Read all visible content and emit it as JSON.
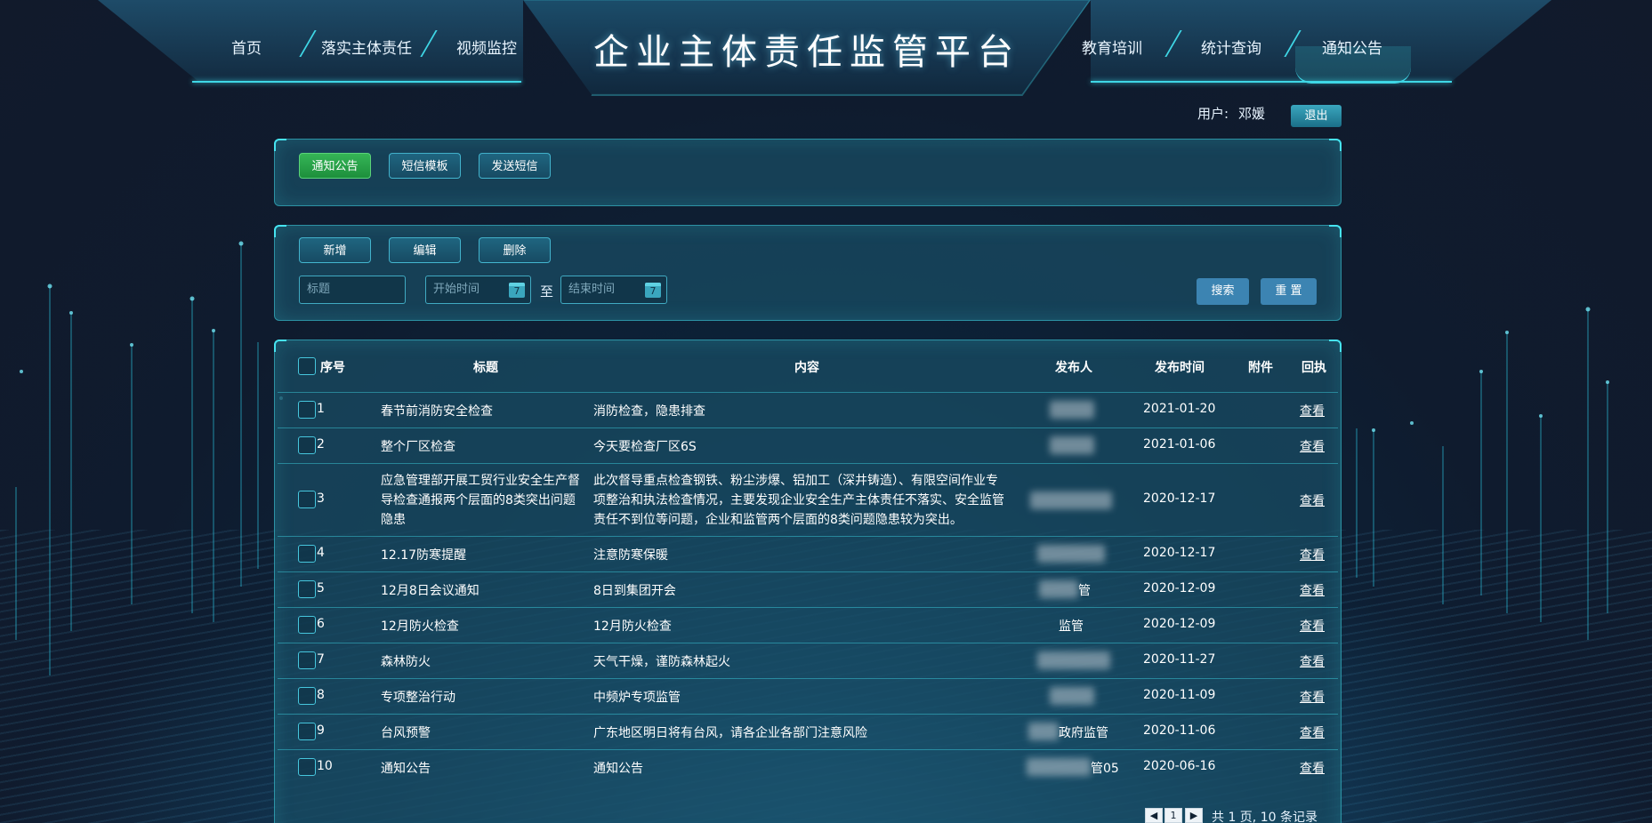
{
  "header": {
    "title": "企业主体责任监管平台",
    "nav_left": [
      "首页",
      "落实主体责任",
      "视频监控"
    ],
    "nav_right": [
      "教育培训",
      "统计查询",
      "通知公告"
    ],
    "active_nav": "通知公告"
  },
  "user": {
    "label": "用户:",
    "name": "邓媛",
    "logout": "退出"
  },
  "tabs": [
    {
      "label": "通知公告",
      "active": true
    },
    {
      "label": "短信模板",
      "active": false
    },
    {
      "label": "发送短信",
      "active": false
    }
  ],
  "actions": {
    "add": "新增",
    "edit": "编辑",
    "delete": "删除"
  },
  "filters": {
    "title_placeholder": "标题",
    "start_placeholder": "开始时间",
    "end_placeholder": "结束时间",
    "to": "至",
    "calendar_icon": "7",
    "search": "搜索",
    "reset": "重 置"
  },
  "table": {
    "columns": [
      "序号",
      "标题",
      "内容",
      "发布人",
      "发布时间",
      "附件",
      "回执"
    ],
    "view_label": "查看",
    "rows": [
      {
        "no": "1",
        "title": "春节前消防安全检查",
        "content": "消防检查，隐患排查",
        "publisher": "",
        "date": "2021-01-20"
      },
      {
        "no": "2",
        "title": "整个厂区检查",
        "content": "今天要检查厂区6S",
        "publisher": "",
        "date": "2021-01-06"
      },
      {
        "no": "3",
        "title": "应急管理部开展工贸行业安全生产督导检查通报两个层面的8类突出问题隐患",
        "content": "此次督导重点检查钢铁、粉尘涉爆、铝加工（深井铸造）、有限空间作业专项整治和执法检查情况，主要发现企业安全生产主体责任不落实、安全监管责任不到位等问题，企业和监管两个层面的8类问题隐患较为突出。",
        "publisher": "",
        "date": "2020-12-17"
      },
      {
        "no": "4",
        "title": "12.17防寒提醒",
        "content": "注意防寒保暖",
        "publisher": "",
        "date": "2020-12-17"
      },
      {
        "no": "5",
        "title": "12月8日会议通知",
        "content": "8日到集团开会",
        "publisher": "管",
        "date": "2020-12-09"
      },
      {
        "no": "6",
        "title": "12月防火检查",
        "content": "12月防火检查",
        "publisher": "监管",
        "date": "2020-12-09"
      },
      {
        "no": "7",
        "title": "森林防火",
        "content": "天气干燥，谨防森林起火",
        "publisher": "",
        "date": "2020-11-27"
      },
      {
        "no": "8",
        "title": "专项整治行动",
        "content": "中频炉专项监管",
        "publisher": "",
        "date": "2020-11-09"
      },
      {
        "no": "9",
        "title": "台风预警",
        "content": "广东地区明日将有台风，请各企业各部门注意风险",
        "publisher": "政府监管",
        "date": "2020-11-06"
      },
      {
        "no": "10",
        "title": "通知公告",
        "content": "通知公告",
        "publisher": "管05",
        "date": "2020-06-16"
      }
    ]
  },
  "pager": {
    "current": "1",
    "summary": "共 1 页, 10 条记录"
  },
  "colors": {
    "accent": "#3fd7e6",
    "active_tab": "#2aa64b",
    "primary_button": "#3c84b2"
  }
}
